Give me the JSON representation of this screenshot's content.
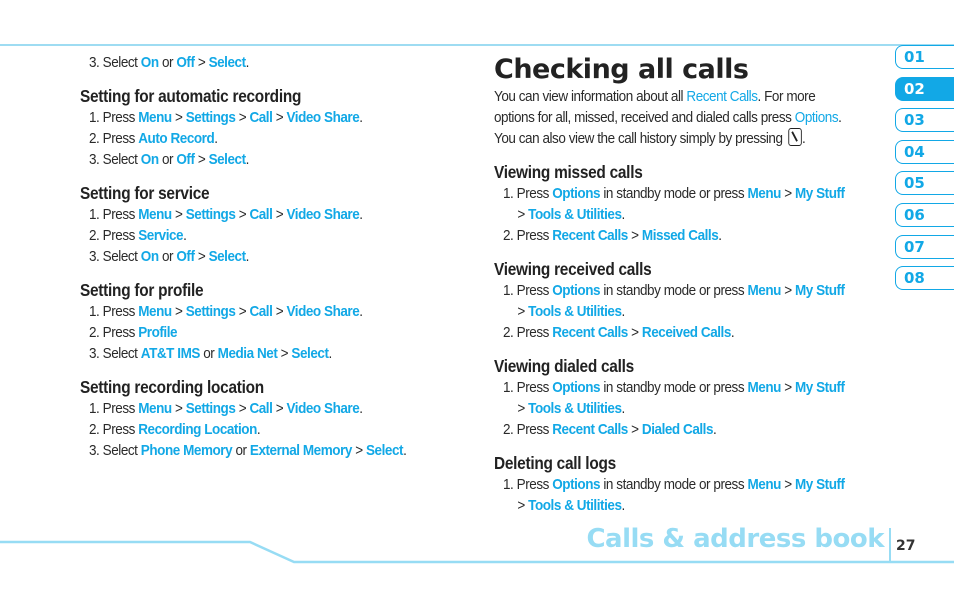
{
  "left_column": {
    "top_steps": [
      [
        {
          "t": "3. Select "
        },
        {
          "t": "On",
          "h": 1
        },
        {
          "t": " or "
        },
        {
          "t": "Off",
          "h": 1
        },
        {
          "t": " > "
        },
        {
          "t": "Select",
          "h": 1
        },
        {
          "t": "."
        }
      ]
    ],
    "sections": [
      {
        "title": "Setting for automatic recording",
        "steps": [
          [
            {
              "t": "1. Press "
            },
            {
              "t": "Menu",
              "h": 1
            },
            {
              "t": " > "
            },
            {
              "t": "Settings",
              "h": 1
            },
            {
              "t": " > "
            },
            {
              "t": "Call",
              "h": 1
            },
            {
              "t": " > "
            },
            {
              "t": "Video Share",
              "h": 1
            },
            {
              "t": "."
            }
          ],
          [
            {
              "t": "2. Press "
            },
            {
              "t": "Auto Record",
              "h": 1
            },
            {
              "t": "."
            }
          ],
          [
            {
              "t": "3. Select "
            },
            {
              "t": "On",
              "h": 1
            },
            {
              "t": " or "
            },
            {
              "t": "Off",
              "h": 1
            },
            {
              "t": " > "
            },
            {
              "t": "Select",
              "h": 1
            },
            {
              "t": "."
            }
          ]
        ]
      },
      {
        "title": "Setting for service",
        "steps": [
          [
            {
              "t": "1. Press "
            },
            {
              "t": "Menu",
              "h": 1
            },
            {
              "t": " > "
            },
            {
              "t": "Settings",
              "h": 1
            },
            {
              "t": " > "
            },
            {
              "t": "Call",
              "h": 1
            },
            {
              "t": " > "
            },
            {
              "t": "Video Share",
              "h": 1
            },
            {
              "t": "."
            }
          ],
          [
            {
              "t": "2. Press "
            },
            {
              "t": "Service",
              "h": 1
            },
            {
              "t": "."
            }
          ],
          [
            {
              "t": "3. Select "
            },
            {
              "t": "On",
              "h": 1
            },
            {
              "t": " or "
            },
            {
              "t": "Off",
              "h": 1
            },
            {
              "t": " > "
            },
            {
              "t": "Select",
              "h": 1
            },
            {
              "t": "."
            }
          ]
        ]
      },
      {
        "title": "Setting for profile",
        "steps": [
          [
            {
              "t": "1. Press "
            },
            {
              "t": "Menu",
              "h": 1
            },
            {
              "t": " > "
            },
            {
              "t": "Settings",
              "h": 1
            },
            {
              "t": " > "
            },
            {
              "t": "Call",
              "h": 1
            },
            {
              "t": " > "
            },
            {
              "t": "Video Share",
              "h": 1
            },
            {
              "t": "."
            }
          ],
          [
            {
              "t": "2. Press "
            },
            {
              "t": "Profile",
              "h": 1
            }
          ],
          [
            {
              "t": "3. Select "
            },
            {
              "t": "AT&T IMS",
              "h": 1
            },
            {
              "t": " or "
            },
            {
              "t": "Media Net",
              "h": 1
            },
            {
              "t": " > "
            },
            {
              "t": "Select",
              "h": 1
            },
            {
              "t": "."
            }
          ]
        ]
      },
      {
        "title": "Setting recording location",
        "steps": [
          [
            {
              "t": "1. Press "
            },
            {
              "t": "Menu",
              "h": 1
            },
            {
              "t": " > "
            },
            {
              "t": "Settings",
              "h": 1
            },
            {
              "t": " > "
            },
            {
              "t": "Call",
              "h": 1
            },
            {
              "t": " > "
            },
            {
              "t": "Video Share",
              "h": 1
            },
            {
              "t": "."
            }
          ],
          [
            {
              "t": "2. Press "
            },
            {
              "t": "Recording Location",
              "h": 1
            },
            {
              "t": "."
            }
          ],
          [
            {
              "t": "3. Select "
            },
            {
              "t": "Phone Memory",
              "h": 1
            },
            {
              "t": " or "
            },
            {
              "t": "External Memory",
              "h": 1
            },
            {
              "t": " > "
            },
            {
              "t": "Select",
              "h": 1
            },
            {
              "t": "."
            }
          ]
        ]
      }
    ]
  },
  "right_column": {
    "page_title": "Checking all calls",
    "intro_lines": [
      [
        {
          "t": "You can view information about all "
        },
        {
          "t": "Recent Calls",
          "l": 1
        },
        {
          "t": ". For more"
        }
      ],
      [
        {
          "t": "options for all, missed, received and dialed calls press "
        },
        {
          "t": "Options",
          "l": 1
        },
        {
          "t": "."
        }
      ],
      [
        {
          "t": "You can also view the call history simply by pressing "
        },
        {
          "icon": "call-key-icon"
        },
        {
          "t": "."
        }
      ]
    ],
    "sections": [
      {
        "title": "Viewing missed calls",
        "steps": [
          [
            {
              "t": "1. Press "
            },
            {
              "t": "Options",
              "h": 1
            },
            {
              "t": " in standby mode or press "
            },
            {
              "t": "Menu",
              "h": 1
            },
            {
              "t": " > "
            },
            {
              "t": "My Stuff",
              "h": 1
            }
          ],
          {
            "cont": [
              {
                "t": "> "
              },
              {
                "t": "Tools & Utilities",
                "h": 1
              },
              {
                "t": "."
              }
            ]
          },
          [
            {
              "t": "2. Press "
            },
            {
              "t": "Recent Calls",
              "h": 1
            },
            {
              "t": " > "
            },
            {
              "t": "Missed Calls",
              "h": 1
            },
            {
              "t": "."
            }
          ]
        ]
      },
      {
        "title": "Viewing received calls",
        "steps": [
          [
            {
              "t": "1. Press "
            },
            {
              "t": "Options",
              "h": 1
            },
            {
              "t": " in standby mode or press "
            },
            {
              "t": "Menu",
              "h": 1
            },
            {
              "t": " > "
            },
            {
              "t": "My Stuff",
              "h": 1
            }
          ],
          {
            "cont": [
              {
                "t": "> "
              },
              {
                "t": "Tools & Utilities",
                "h": 1
              },
              {
                "t": "."
              }
            ]
          },
          [
            {
              "t": "2. Press "
            },
            {
              "t": "Recent Calls",
              "h": 1
            },
            {
              "t": " > "
            },
            {
              "t": "Received Calls",
              "h": 1
            },
            {
              "t": "."
            }
          ]
        ]
      },
      {
        "title": "Viewing dialed calls",
        "steps": [
          [
            {
              "t": "1. Press "
            },
            {
              "t": "Options",
              "h": 1
            },
            {
              "t": " in standby mode or press "
            },
            {
              "t": "Menu",
              "h": 1
            },
            {
              "t": " > "
            },
            {
              "t": "My Stuff",
              "h": 1
            }
          ],
          {
            "cont": [
              {
                "t": "> "
              },
              {
                "t": "Tools & Utilities",
                "h": 1
              },
              {
                "t": "."
              }
            ]
          },
          [
            {
              "t": "2. Press "
            },
            {
              "t": "Recent Calls",
              "h": 1
            },
            {
              "t": " > "
            },
            {
              "t": "Dialed Calls",
              "h": 1
            },
            {
              "t": "."
            }
          ]
        ]
      },
      {
        "title": "Deleting call logs",
        "steps": [
          [
            {
              "t": "1. Press "
            },
            {
              "t": "Options",
              "h": 1
            },
            {
              "t": " in standby mode or press "
            },
            {
              "t": "Menu",
              "h": 1
            },
            {
              "t": " > "
            },
            {
              "t": "My Stuff",
              "h": 1
            }
          ],
          {
            "cont": [
              {
                "t": "> "
              },
              {
                "t": "Tools & Utilities",
                "h": 1
              },
              {
                "t": "."
              }
            ]
          }
        ]
      }
    ]
  },
  "chapter_tabs": {
    "items": [
      "01",
      "02",
      "03",
      "04",
      "05",
      "06",
      "07",
      "08"
    ],
    "active": "02"
  },
  "footer": {
    "chapter_title": "Calls & address book",
    "page_number": "27"
  },
  "colors": {
    "accent": "#12a8e6",
    "rule_light": "#97dcf4",
    "text": "#2a2a2a"
  }
}
